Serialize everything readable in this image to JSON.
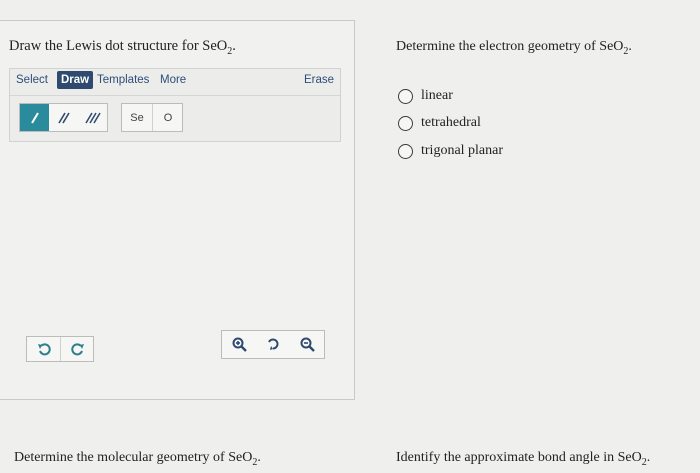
{
  "left_question": {
    "text": "Draw the Lewis dot structure for SeO",
    "sub": "2",
    "end": "."
  },
  "editor": {
    "tabs": [
      "Select",
      "Draw",
      "Templates",
      "More"
    ],
    "active_tab": "Draw",
    "erase_label": "Erase",
    "bond_tools": [
      "single-bond",
      "double-bond",
      "triple-bond"
    ],
    "atoms": [
      "Se",
      "O"
    ]
  },
  "right_question": {
    "text": "Determine the electron geometry of SeO",
    "sub": "2",
    "end": ".",
    "options": [
      "linear",
      "tetrahedral",
      "trigonal planar"
    ]
  },
  "bottom_left_question": {
    "text": "Determine the molecular geometry of SeO",
    "sub": "2",
    "end": "."
  },
  "bottom_right_question": {
    "text": "Identify the approximate bond angle in SeO",
    "sub": "2",
    "end": "."
  },
  "colors": {
    "accent": "#2e4a6e",
    "selected_tool": "#2a8b9c",
    "link": "#2d4e78"
  }
}
